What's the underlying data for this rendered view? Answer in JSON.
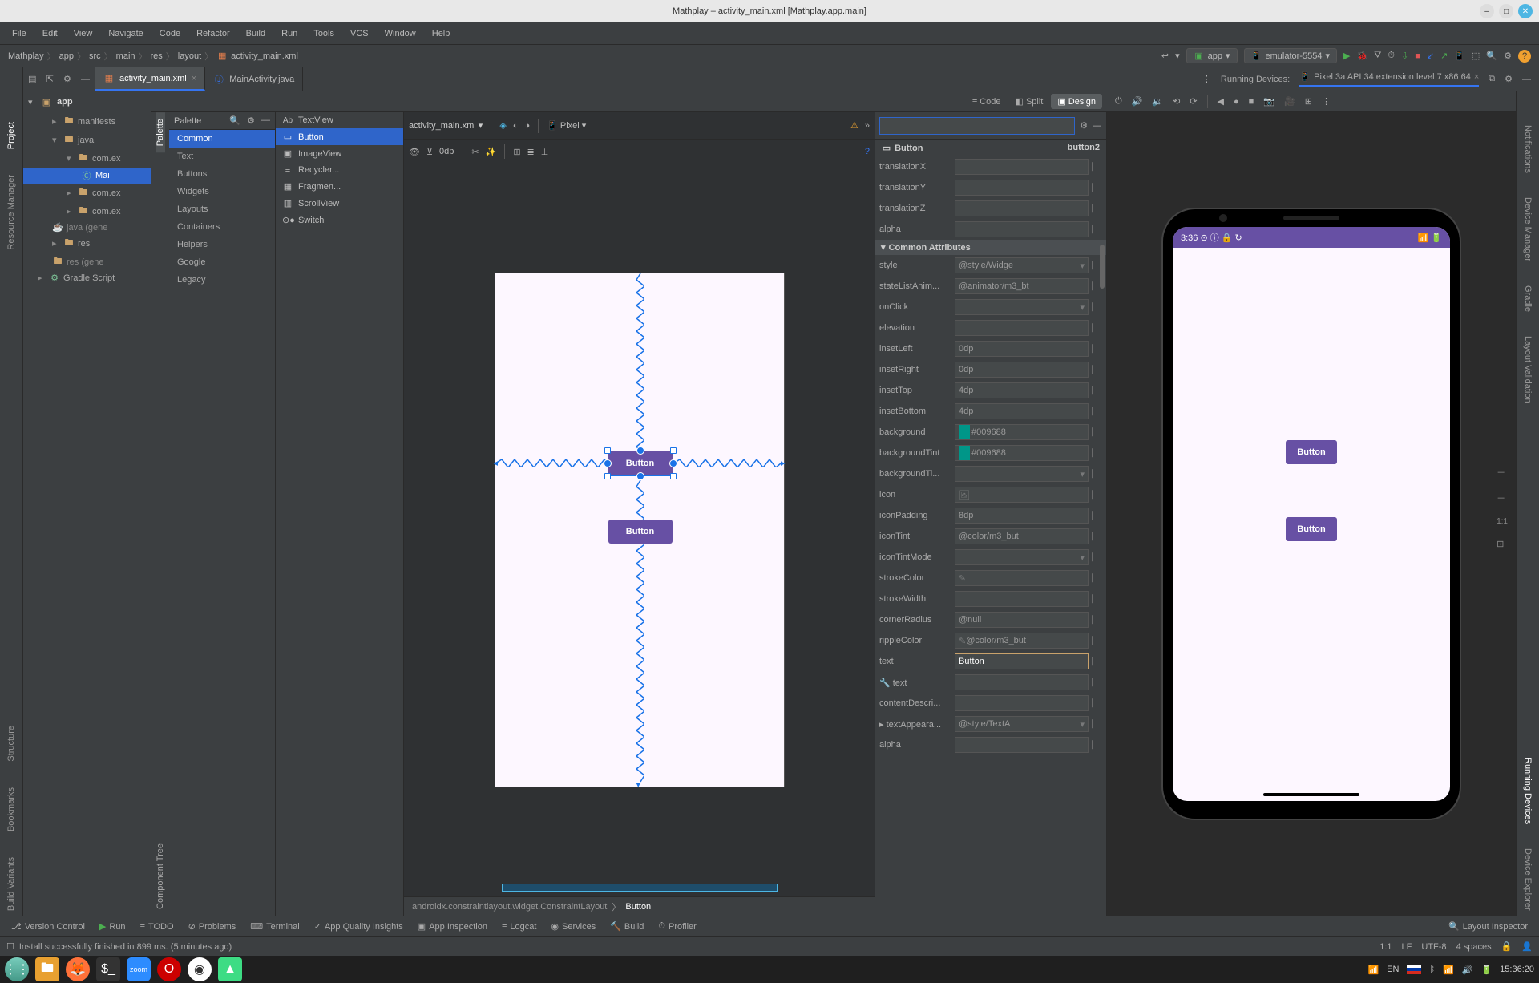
{
  "title": "Mathplay – activity_main.xml [Mathplay.app.main]",
  "menubar": [
    "File",
    "Edit",
    "View",
    "Navigate",
    "Code",
    "Refactor",
    "Build",
    "Run",
    "Tools",
    "VCS",
    "Window",
    "Help"
  ],
  "breadcrumbs": [
    "Mathplay",
    "app",
    "src",
    "main",
    "res",
    "layout",
    "activity_main.xml"
  ],
  "runTarget": "app",
  "device": "emulator-5554",
  "openTabs": [
    {
      "name": "activity_main.xml",
      "active": true
    },
    {
      "name": "MainActivity.java",
      "active": false
    }
  ],
  "runningDevicesLabel": "Running Devices:",
  "runningDevice": "Pixel 3a API 34 extension level 7 x86 64",
  "viewModes": {
    "code": "Code",
    "split": "Split",
    "design": "Design"
  },
  "leftRails": [
    "Project",
    "Resource Manager",
    "Structure",
    "Bookmarks",
    "Build Variants"
  ],
  "rightRails": [
    "Notifications",
    "Device Manager",
    "Gradle",
    "Layout Validation",
    "Running Devices",
    "Device Explorer"
  ],
  "projectTree": {
    "root": "app",
    "items": [
      {
        "l": 2,
        "c": "▸",
        "t": "manifests"
      },
      {
        "l": 2,
        "c": "▾",
        "t": "java"
      },
      {
        "l": 3,
        "c": "▾",
        "t": "com.ex"
      },
      {
        "l": 4,
        "c": "",
        "t": "Mai",
        "sel": true,
        "icon": "Ⓒ"
      },
      {
        "l": 3,
        "c": "▸",
        "t": "com.ex"
      },
      {
        "l": 3,
        "c": "▸",
        "t": "com.ex"
      },
      {
        "l": 2,
        "c": "",
        "t": "java (gene",
        "gray": true
      },
      {
        "l": 2,
        "c": "▸",
        "t": "res"
      },
      {
        "l": 2,
        "c": "",
        "t": "res (gene",
        "gray": true
      }
    ],
    "gradle": "Gradle Script"
  },
  "palette": {
    "title": "Palette",
    "vTabs": [
      "Palette",
      "Component Tree"
    ],
    "categories": [
      "Common",
      "Text",
      "Buttons",
      "Widgets",
      "Layouts",
      "Containers",
      "Helpers",
      "Google",
      "Legacy"
    ],
    "widgets": [
      {
        "icon": "Ab",
        "label": "TextView"
      },
      {
        "icon": "▭",
        "label": "Button",
        "active": true
      },
      {
        "icon": "▣",
        "label": "ImageView"
      },
      {
        "icon": "≡",
        "label": "Recycler..."
      },
      {
        "icon": "▦",
        "label": "Fragmen..."
      },
      {
        "icon": "▥",
        "label": "ScrollView"
      },
      {
        "icon": "⊙",
        "label": "Switch"
      }
    ]
  },
  "canvasToolbar": {
    "file": "activity_main.xml",
    "deviceSel": "Pixel",
    "zoom": "0dp"
  },
  "canvas": {
    "button1": "Button",
    "button2": "Button"
  },
  "compCrumb": [
    "androidx.constraintlayout.widget.ConstraintLayout",
    "Button"
  ],
  "attributes": {
    "componentType": "Button",
    "componentId": "button2",
    "search": "",
    "rows": [
      {
        "label": "translationX",
        "value": ""
      },
      {
        "label": "translationY",
        "value": ""
      },
      {
        "label": "translationZ",
        "value": ""
      },
      {
        "label": "alpha",
        "value": ""
      }
    ],
    "sectionTitle": "Common Attributes",
    "rows2": [
      {
        "label": "style",
        "value": "@style/Widge",
        "dd": true
      },
      {
        "label": "stateListAnim...",
        "value": "@animator/m3_bt"
      },
      {
        "label": "onClick",
        "value": "",
        "dd": true
      },
      {
        "label": "elevation",
        "value": ""
      },
      {
        "label": "insetLeft",
        "value": "0dp"
      },
      {
        "label": "insetRight",
        "value": "0dp"
      },
      {
        "label": "insetTop",
        "value": "4dp"
      },
      {
        "label": "insetBottom",
        "value": "4dp"
      },
      {
        "label": "background",
        "value": "#009688",
        "color": "#009688"
      },
      {
        "label": "backgroundTint",
        "value": "#009688",
        "color": "#009688"
      },
      {
        "label": "backgroundTi...",
        "value": "",
        "dd": true
      },
      {
        "label": "icon",
        "value": "",
        "img": true
      },
      {
        "label": "iconPadding",
        "value": "8dp"
      },
      {
        "label": "iconTint",
        "value": "@color/m3_but"
      },
      {
        "label": "iconTintMode",
        "value": "",
        "dd": true
      },
      {
        "label": "strokeColor",
        "value": "",
        "pen": true
      },
      {
        "label": "strokeWidth",
        "value": ""
      },
      {
        "label": "cornerRadius",
        "value": "@null"
      },
      {
        "label": "rippleColor",
        "value": "@color/m3_but",
        "pen": true
      },
      {
        "label": "text",
        "value": "Button",
        "hl": true
      },
      {
        "label": "text",
        "value": "",
        "wrench": true
      },
      {
        "label": "contentDescri...",
        "value": ""
      },
      {
        "label": "textAppeara...",
        "value": "@style/TextA",
        "dd": true,
        "chev": true
      },
      {
        "label": "alpha",
        "value": ""
      }
    ]
  },
  "emulator": {
    "time": "3:36",
    "buttons": [
      "Button",
      "Button"
    ]
  },
  "bottomTools": [
    "Version Control",
    "Run",
    "TODO",
    "Problems",
    "Terminal",
    "App Quality Insights",
    "App Inspection",
    "Logcat",
    "Services",
    "Build",
    "Profiler"
  ],
  "bottomToolsRight": "Layout Inspector",
  "statusMsg": "Install successfully finished in 899 ms. (5 minutes ago)",
  "statusRight": {
    "pos": "1:1",
    "le": "LF",
    "enc": "UTF-8",
    "indent": "4 spaces"
  },
  "taskbar": {
    "lang": "EN",
    "time": "15:36:20"
  }
}
